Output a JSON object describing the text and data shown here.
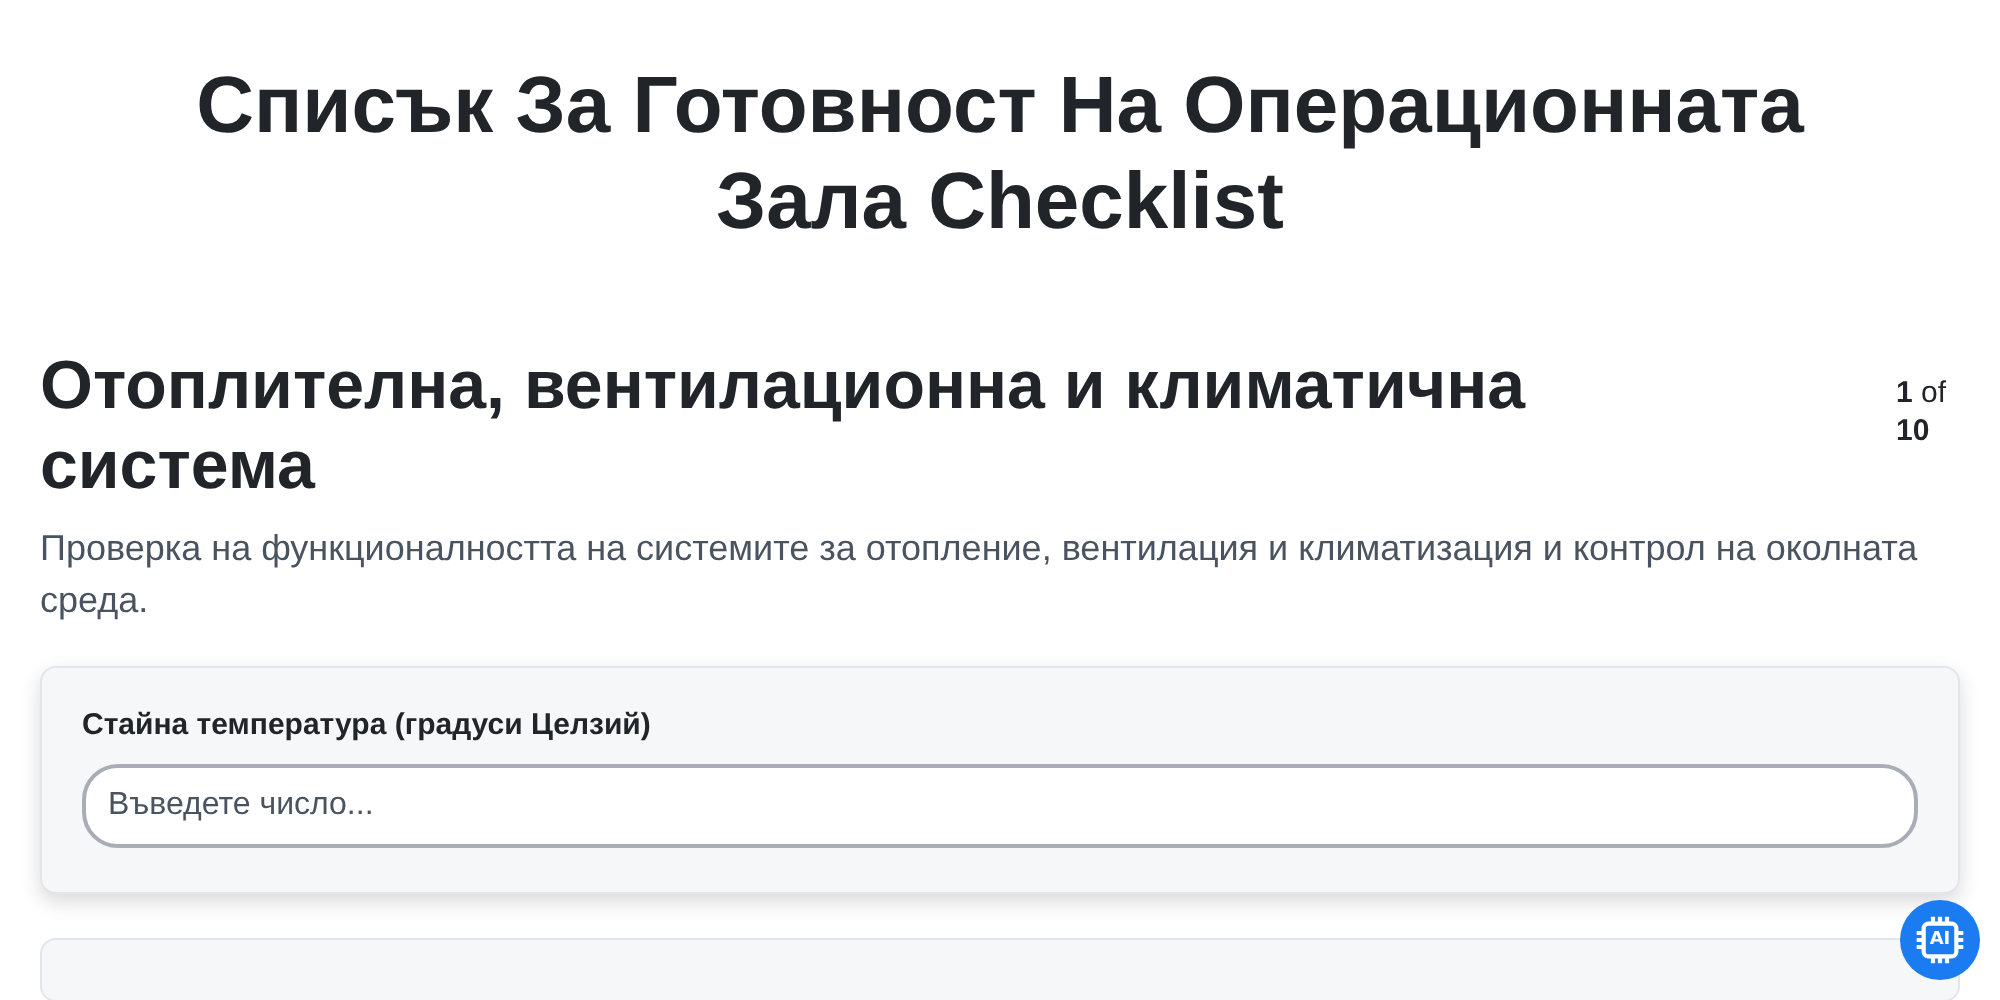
{
  "title": "Списък За Готовност На Операционната Зала Checklist",
  "section": {
    "heading": "Отоплителна, вентилационна и климатична система",
    "progress": "**1** of **10**",
    "description": "Проверка на функционалността на системите за отопление, вентилация и климатизация и контрол на околната среда."
  },
  "questions": [
    {
      "label": "Стайна температура (градуси Целзий)",
      "placeholder": "Въведете число..."
    }
  ],
  "ai_badge": {
    "label": "AI"
  }
}
